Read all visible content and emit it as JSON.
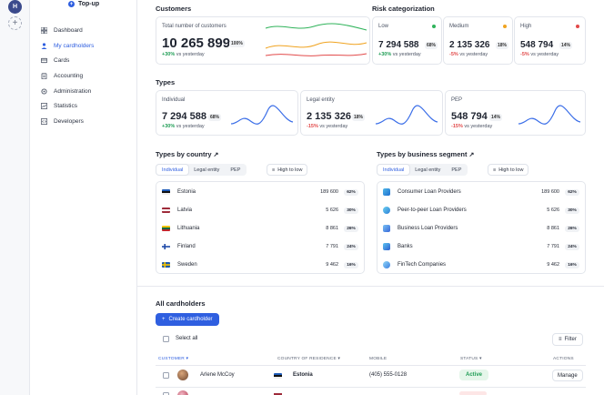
{
  "rail": {
    "avatar_letter": "H"
  },
  "sidebar": {
    "topup_label": "Top-up",
    "items": [
      {
        "label": "Dashboard",
        "icon": "dashboard-icon"
      },
      {
        "label": "My cardholders",
        "icon": "user-icon",
        "active": true
      },
      {
        "label": "Cards",
        "icon": "card-icon"
      },
      {
        "label": "Accounting",
        "icon": "clipboard-icon"
      },
      {
        "label": "Administration",
        "icon": "gear-icon"
      },
      {
        "label": "Statistics",
        "icon": "chart-icon"
      },
      {
        "label": "Developers",
        "icon": "code-icon"
      }
    ]
  },
  "customers": {
    "title": "Customers",
    "card_label": "Total number of customers",
    "value": "10 265 899",
    "pct": "100%",
    "delta": "+30%",
    "delta_suffix": "vs yesterday"
  },
  "risk": {
    "title": "Risk categorization",
    "items": [
      {
        "label": "Low",
        "value": "7 294 588",
        "pct": "68%",
        "delta": "+30%",
        "delta_suffix": "vs yesterday",
        "dot_color": "#2fb35a"
      },
      {
        "label": "Medium",
        "value": "2 135 326",
        "pct": "18%",
        "delta": "-5%",
        "delta_suffix": "vs yesterday",
        "dot_color": "#f0a320"
      },
      {
        "label": "High",
        "value": "548 794",
        "pct": "14%",
        "delta": "-5%",
        "delta_suffix": "vs yesterday",
        "dot_color": "#e24a4a"
      }
    ]
  },
  "types": {
    "title": "Types",
    "items": [
      {
        "label": "Individual",
        "value": "7 294 588",
        "pct": "68%",
        "delta": "+30%",
        "delta_suffix": "vs yesterday"
      },
      {
        "label": "Legal entity",
        "value": "2 135 326",
        "pct": "18%",
        "delta": "-15%",
        "delta_suffix": "vs yesterday"
      },
      {
        "label": "PEP",
        "value": "548 794",
        "pct": "14%",
        "delta": "-15%",
        "delta_suffix": "vs yesterday"
      }
    ]
  },
  "by_country": {
    "title": "Types by country",
    "tabs": [
      "Individual",
      "Legal entity",
      "PEP"
    ],
    "sort_label": "High to low",
    "rows": [
      {
        "label": "Estonia",
        "value": "189 600",
        "pct": "62%"
      },
      {
        "label": "Latvia",
        "value": "5 626",
        "pct": "30%"
      },
      {
        "label": "Lithuania",
        "value": "8 861",
        "pct": "26%"
      },
      {
        "label": "Finland",
        "value": "7 791",
        "pct": "24%"
      },
      {
        "label": "Sweden",
        "value": "9 462",
        "pct": "16%"
      }
    ]
  },
  "by_segment": {
    "title": "Types by business segment",
    "tabs": [
      "Individual",
      "Legal entity",
      "PEP"
    ],
    "sort_label": "High to low",
    "rows": [
      {
        "label": "Consumer Loan Providers",
        "value": "189 600",
        "pct": "62%"
      },
      {
        "label": "Peer-to-peer Loan Providers",
        "value": "5 626",
        "pct": "30%"
      },
      {
        "label": "Business Loan Providers",
        "value": "8 861",
        "pct": "26%"
      },
      {
        "label": "Banks",
        "value": "7 791",
        "pct": "24%"
      },
      {
        "label": "FinTech Companies",
        "value": "9 462",
        "pct": "16%"
      }
    ]
  },
  "cardholders": {
    "title": "All cardholders",
    "create_label": "Create cardholder",
    "select_all_label": "Select all",
    "filter_label": "Filter",
    "columns": {
      "customer": "Customer",
      "country": "Country of residence",
      "mobile": "Mobile",
      "status": "Status",
      "actions": "Actions"
    },
    "rows": [
      {
        "name": "Arlene McCoy",
        "country": "Estonia",
        "mobile": "(405) 555-0128",
        "status": "Active",
        "action": "Manage"
      }
    ]
  }
}
